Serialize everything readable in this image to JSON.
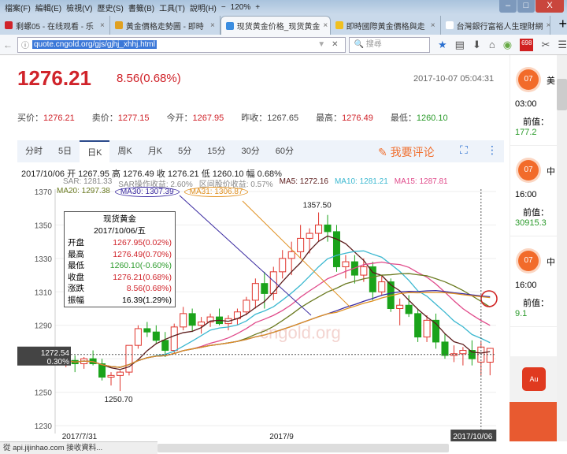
{
  "menu": [
    "檔案(F)",
    "編輯(E)",
    "檢視(V)",
    "歷史(S)",
    "書籤(B)",
    "工具(T)",
    "說明(H)"
  ],
  "zoom": "120%",
  "tabs": [
    {
      "label": "剩螺05 - 在线观看 - 乐",
      "color": "#d0232a"
    },
    {
      "label": "黃金價格走勢圖 - 即時",
      "color": "#e0a020"
    },
    {
      "label": "现货黄金价格_现货黄金",
      "color": "#3b8de0"
    },
    {
      "label": "即時國際黃金價格與走",
      "color": "#f0c020"
    },
    {
      "label": "台灣銀行富裕人生理財網",
      "color": "#fff"
    }
  ],
  "url": "quote.cngold.org/gjs/gjhj_xhhj.html",
  "search_placeholder": "搜尋",
  "badge_count": "698",
  "price": "1276.21",
  "change": "8.56(0.68%)",
  "timestamp": "2017-10-07 05:04:31",
  "quotes": [
    {
      "label": "买价：",
      "value": "1276.21",
      "color": "red"
    },
    {
      "label": "卖价：",
      "value": "1277.15",
      "color": "red"
    },
    {
      "label": "今开：",
      "value": "1267.95",
      "color": "red"
    },
    {
      "label": "昨收：",
      "value": "1267.65",
      "color": ""
    },
    {
      "label": "最高：",
      "value": "1276.49",
      "color": "red"
    },
    {
      "label": "最低：",
      "value": "1260.10",
      "color": "green"
    }
  ],
  "ktabs": [
    "分时",
    "5日",
    "日K",
    "周K",
    "月K",
    "5分",
    "15分",
    "30分",
    "60分"
  ],
  "comment": "我要评论",
  "info_line": "2017/10/06  开 1267.95  高 1276.49  收 1276.21  低 1260.10  幅 0.68%",
  "indicators": [
    {
      "t": "SAR: 1281.33",
      "c": "#888"
    },
    {
      "t": "SAR操作收益: 2.60%",
      "c": "#888"
    },
    {
      "t": "区间股价收益: 0.57%",
      "c": "#888"
    },
    {
      "t": "MA5: 1272.16",
      "c": "#5a1a1a"
    },
    {
      "t": "MA10: 1281.21",
      "c": "#3bb8d0"
    },
    {
      "t": "MA15: 1287.81",
      "c": "#e04a8a"
    }
  ],
  "indicators2": [
    {
      "t": "MA20: 1297.38",
      "c": "#6a7a20"
    },
    {
      "t": "MA30: 1307.39",
      "c": "#3a2aa0"
    },
    {
      "t": "MA31: 1306.87",
      "c": "#e09020"
    }
  ],
  "tooltip": {
    "title": "现货黄金",
    "date": "2017/10/06/五",
    "rows": [
      {
        "k": "开盘",
        "v": "1267.95(0.02%)",
        "c": "red"
      },
      {
        "k": "最高",
        "v": "1276.49(0.70%)",
        "c": "red"
      },
      {
        "k": "最低",
        "v": "1260.10(-0.60%)",
        "c": "green"
      },
      {
        "k": "收盘",
        "v": "1276.21(0.68%)",
        "c": "red"
      },
      {
        "k": "涨跌",
        "v": "8.56(0.68%)",
        "c": "red"
      },
      {
        "k": "振幅",
        "v": "16.39(1.29%)",
        "c": ""
      }
    ]
  },
  "events": [
    {
      "day": "07",
      "title": "美",
      "time": "03:00",
      "prev_label": "前值：",
      "prev": "177.2"
    },
    {
      "day": "07",
      "title": "中",
      "time": "16:00",
      "prev_label": "前值：",
      "prev": "30915.3"
    },
    {
      "day": "07",
      "title": "中",
      "time": "16:00",
      "prev_label": "前值：",
      "prev": "9.1"
    }
  ],
  "status": "從 api.jijinhao.com 接收資料...",
  "watermark": "cngold.org",
  "chart_data": {
    "type": "candlestick",
    "ylim": [
      1230,
      1370
    ],
    "yticks": [
      1230,
      1250,
      1270,
      1290,
      1310,
      1330,
      1350,
      1370
    ],
    "xlabels": [
      {
        "i": 0,
        "t": "2017/7/31"
      },
      {
        "i": 23,
        "t": "2017/9"
      },
      {
        "i": 47,
        "t": "2017/10/06"
      }
    ],
    "cursor_price": "1272.54",
    "cursor_pct": "0.30%",
    "max_label": "1357.50",
    "min_label": "1250.70",
    "ohlc": [
      [
        1268,
        1274,
        1265,
        1269
      ],
      [
        1269,
        1272,
        1262,
        1267
      ],
      [
        1267,
        1271,
        1264,
        1270
      ],
      [
        1270,
        1275,
        1266,
        1267
      ],
      [
        1267,
        1270,
        1257,
        1259
      ],
      [
        1259,
        1262,
        1254,
        1260
      ],
      [
        1260,
        1263,
        1250.7,
        1262
      ],
      [
        1262,
        1275,
        1260,
        1278
      ],
      [
        1278,
        1290,
        1276,
        1288
      ],
      [
        1288,
        1292,
        1283,
        1286
      ],
      [
        1286,
        1290,
        1279,
        1281
      ],
      [
        1281,
        1286,
        1271,
        1275
      ],
      [
        1275,
        1291,
        1273,
        1289
      ],
      [
        1289,
        1301,
        1287,
        1297
      ],
      [
        1297,
        1300,
        1286,
        1290
      ],
      [
        1290,
        1295,
        1285,
        1292
      ],
      [
        1292,
        1297,
        1289,
        1295
      ],
      [
        1295,
        1300,
        1290,
        1291
      ],
      [
        1291,
        1296,
        1287,
        1294
      ],
      [
        1294,
        1300,
        1290,
        1298
      ],
      [
        1298,
        1307,
        1296,
        1305
      ],
      [
        1305,
        1318,
        1300,
        1315
      ],
      [
        1315,
        1322,
        1300,
        1309
      ],
      [
        1309,
        1325,
        1305,
        1322
      ],
      [
        1322,
        1335,
        1318,
        1330
      ],
      [
        1330,
        1340,
        1320,
        1334
      ],
      [
        1334,
        1350,
        1330,
        1342
      ],
      [
        1342,
        1348,
        1333,
        1345
      ],
      [
        1345,
        1357.5,
        1340,
        1350
      ],
      [
        1350,
        1356,
        1340,
        1346
      ],
      [
        1346,
        1350,
        1322,
        1325
      ],
      [
        1325,
        1332,
        1318,
        1328
      ],
      [
        1328,
        1332,
        1315,
        1320
      ],
      [
        1320,
        1330,
        1316,
        1325
      ],
      [
        1325,
        1328,
        1305,
        1310
      ],
      [
        1310,
        1320,
        1308,
        1316
      ],
      [
        1316,
        1318,
        1298,
        1300
      ],
      [
        1300,
        1306,
        1290,
        1302
      ],
      [
        1302,
        1308,
        1295,
        1297
      ],
      [
        1297,
        1300,
        1280,
        1283
      ],
      [
        1283,
        1296,
        1280,
        1293
      ],
      [
        1293,
        1297,
        1276,
        1280
      ],
      [
        1280,
        1285,
        1270,
        1272
      ],
      [
        1272,
        1278,
        1268,
        1273
      ],
      [
        1273,
        1277,
        1266,
        1275
      ],
      [
        1275,
        1281,
        1266,
        1270
      ],
      [
        1268,
        1280,
        1260,
        1277
      ],
      [
        1267.95,
        1276.49,
        1260.1,
        1276.21
      ]
    ],
    "ma": [
      {
        "name": "MA5",
        "n": 5,
        "color": "#5a1a1a"
      },
      {
        "name": "MA10",
        "n": 10,
        "color": "#3bb8d0"
      },
      {
        "name": "MA15",
        "n": 15,
        "color": "#e04a8a"
      },
      {
        "name": "MA20",
        "n": 20,
        "color": "#6a7a20"
      },
      {
        "name": "MA30",
        "n": 30,
        "color": "#3a2aa0"
      },
      {
        "name": "MA31",
        "n": 31,
        "color": "#e09020"
      }
    ]
  }
}
